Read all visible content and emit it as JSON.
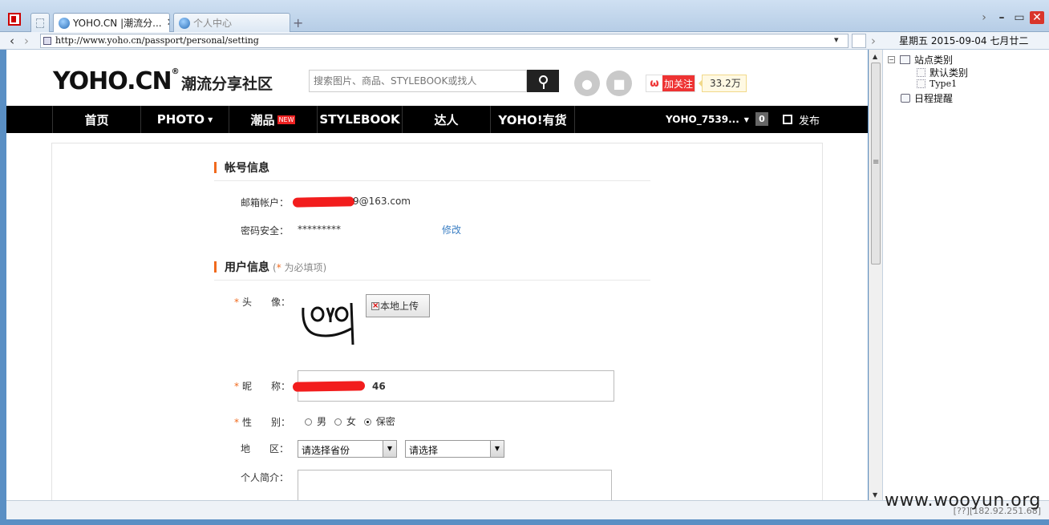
{
  "browser": {
    "tabs": [
      {
        "label": "YOHO.CN |潮流分..."
      },
      {
        "label": "个人中心"
      }
    ],
    "new_tab_symbol": "+",
    "url": "http://www.yoho.cn/passport/personal/setting",
    "date_text": "星期五 2015-09-04 七月廿二",
    "window_controls": {
      "minimize": "–",
      "maximize": "▭",
      "close": "✕"
    }
  },
  "sidepanel": {
    "root_label": "站点类别",
    "children": [
      {
        "label": "默认类别"
      },
      {
        "label": "Type1"
      }
    ],
    "schedule_label": "日程提醒"
  },
  "statusbar": {
    "right_text": "[??][182.92.251.68]"
  },
  "watermark": "www.wooyun.org",
  "header": {
    "logo_text": "YOHO.CN",
    "logo_reg": "®",
    "slogan": "潮流分享社区",
    "search_placeholder": "搜索图片、商品、STYLEBOOK或找人",
    "weibo_follow": "加关注",
    "weibo_count": "33.2万"
  },
  "nav": {
    "items": [
      {
        "label": "首页"
      },
      {
        "label": "PHOTO"
      },
      {
        "label": "潮品",
        "badge": "NEW"
      },
      {
        "label": "STYLEBOOK"
      },
      {
        "label": "达人"
      },
      {
        "label": "YOHO!有货"
      }
    ],
    "user": "YOHO_7539...",
    "notice_count": "0",
    "publish": "发布"
  },
  "account": {
    "title": "帐号信息",
    "email_label": "邮箱帐户：",
    "email_value_visible": "9@163.com",
    "password_label": "密码安全：",
    "password_value": "*********",
    "edit_link": "修改"
  },
  "user_info": {
    "title": "用户信息",
    "hint_open": "(",
    "hint_star": "*",
    "hint_text": " 为必填项)",
    "required_mark": "*",
    "avatar_label": "头　　像：",
    "upload_button": "本地上传",
    "nickname_label": "昵　　称：",
    "nickname_value_visible": "46",
    "gender_label": "性　　别：",
    "gender_options": [
      {
        "label": "男",
        "selected": false
      },
      {
        "label": "女",
        "selected": false
      },
      {
        "label": "保密",
        "selected": true
      }
    ],
    "region_label": "地　　区：",
    "province_select": "请选择省份",
    "city_select": "请选择",
    "bio_label": "个人简介："
  }
}
